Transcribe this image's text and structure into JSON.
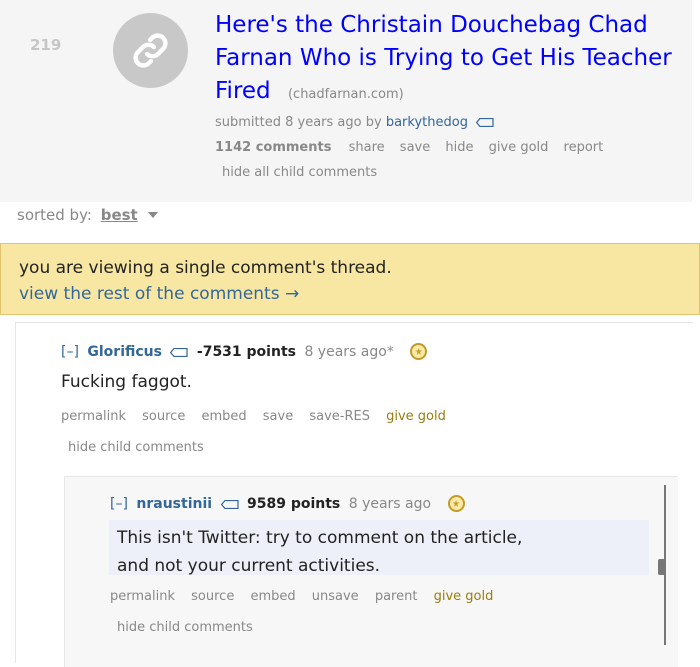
{
  "post": {
    "score": "219",
    "title": "Here's the Christain Douchebag Chad Farnan Who is Trying to Get His Teacher Fired",
    "domain": "(chadfarnan.com)",
    "submitted_prefix": "submitted",
    "submitted_time": "8 years ago",
    "by": "by",
    "author": "barkythedog",
    "comments_count": "1142 comments",
    "actions": [
      "share",
      "save",
      "hide",
      "give gold",
      "report"
    ],
    "hide_all": "hide all child comments"
  },
  "sort": {
    "label": "sorted by:",
    "value": "best"
  },
  "notice": {
    "text": "you are viewing a single comment's thread.",
    "link": "view the rest of the comments →"
  },
  "comments": [
    {
      "expand": "[–]",
      "author": "Glorificus",
      "points": "-7531 points",
      "time": "8 years ago*",
      "body": "Fucking faggot.",
      "actions": [
        "permalink",
        "source",
        "embed",
        "save",
        "save-RES",
        "give gold"
      ],
      "hide": "hide child comments"
    },
    {
      "expand": "[–]",
      "author": "nraustinii",
      "points": "9589 points",
      "time": "8 years ago",
      "body_line1": "This isn't Twitter: try to comment on the article,",
      "body_line2": "and not your current activities.",
      "actions": [
        "permalink",
        "source",
        "embed",
        "unsave",
        "parent",
        "give gold"
      ],
      "hide": "hide child comments"
    }
  ],
  "colors": {
    "link_blue": "#0000ff",
    "meta_blue": "#336699",
    "notice_bg": "#f8e7a2",
    "gold": "#9a7d0a"
  }
}
